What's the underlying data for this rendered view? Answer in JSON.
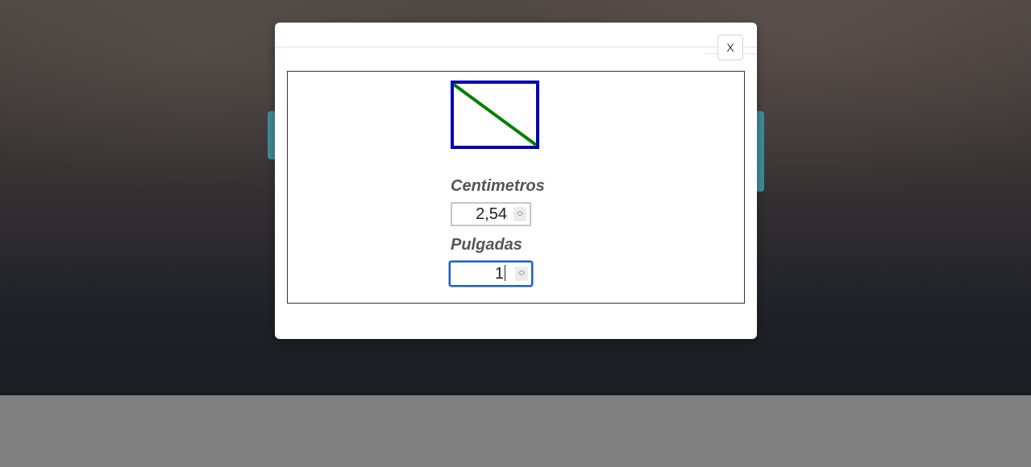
{
  "modal": {
    "close_label": "X"
  },
  "converter": {
    "cm_label": "Centimetros",
    "cm_value": "2,54",
    "in_label": "Pulgadas",
    "in_value": "1"
  },
  "diagram": {
    "rect_color": "#0000b3",
    "diagonal_color": "#008000"
  },
  "spinner_icons": {
    "up": "up-chevron",
    "down": "down-chevron"
  }
}
